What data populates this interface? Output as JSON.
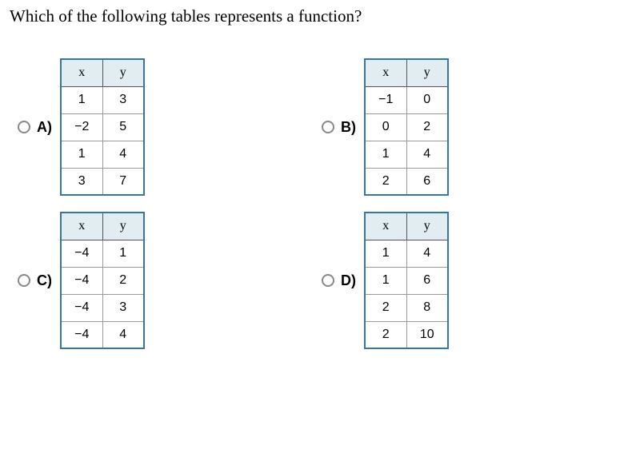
{
  "question": "Which of the following tables represents a function?",
  "headers": {
    "x": "x",
    "y": "y"
  },
  "options": {
    "a": {
      "label": "A)",
      "rows": [
        {
          "x": "1",
          "y": "3"
        },
        {
          "x": "−2",
          "y": "5"
        },
        {
          "x": "1",
          "y": "4"
        },
        {
          "x": "3",
          "y": "7"
        }
      ]
    },
    "b": {
      "label": "B)",
      "rows": [
        {
          "x": "−1",
          "y": "0"
        },
        {
          "x": "0",
          "y": "2"
        },
        {
          "x": "1",
          "y": "4"
        },
        {
          "x": "2",
          "y": "6"
        }
      ]
    },
    "c": {
      "label": "C)",
      "rows": [
        {
          "x": "−4",
          "y": "1"
        },
        {
          "x": "−4",
          "y": "2"
        },
        {
          "x": "−4",
          "y": "3"
        },
        {
          "x": "−4",
          "y": "4"
        }
      ]
    },
    "d": {
      "label": "D)",
      "rows": [
        {
          "x": "1",
          "y": "4"
        },
        {
          "x": "1",
          "y": "6"
        },
        {
          "x": "2",
          "y": "8"
        },
        {
          "x": "2",
          "y": "10"
        }
      ]
    }
  },
  "chart_data": [
    {
      "type": "table",
      "option": "A",
      "columns": [
        "x",
        "y"
      ],
      "rows": [
        [
          1,
          3
        ],
        [
          -2,
          5
        ],
        [
          1,
          4
        ],
        [
          3,
          7
        ]
      ]
    },
    {
      "type": "table",
      "option": "B",
      "columns": [
        "x",
        "y"
      ],
      "rows": [
        [
          -1,
          0
        ],
        [
          0,
          2
        ],
        [
          1,
          4
        ],
        [
          2,
          6
        ]
      ]
    },
    {
      "type": "table",
      "option": "C",
      "columns": [
        "x",
        "y"
      ],
      "rows": [
        [
          -4,
          1
        ],
        [
          -4,
          2
        ],
        [
          -4,
          3
        ],
        [
          -4,
          4
        ]
      ]
    },
    {
      "type": "table",
      "option": "D",
      "columns": [
        "x",
        "y"
      ],
      "rows": [
        [
          1,
          4
        ],
        [
          1,
          6
        ],
        [
          2,
          8
        ],
        [
          2,
          10
        ]
      ]
    }
  ]
}
